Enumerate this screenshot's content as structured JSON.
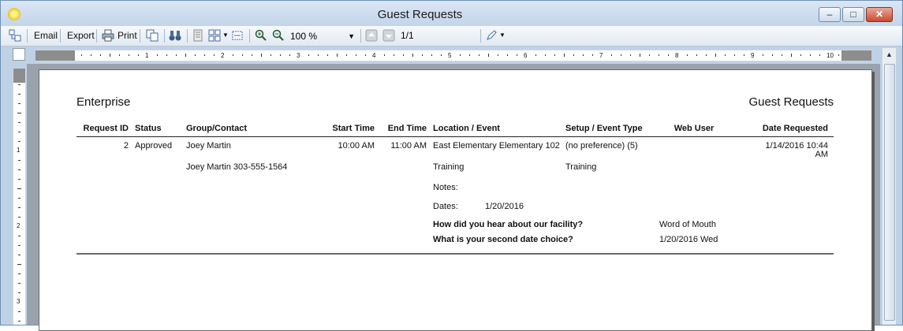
{
  "window": {
    "title": "Guest Requests",
    "minimize": "–",
    "maximize": "□",
    "close": "✕"
  },
  "toolbar": {
    "email": "Email",
    "export": "Export",
    "print": "Print",
    "zoom": "100 %",
    "page": "1/1"
  },
  "ruler": {
    "h_labels": [
      "1",
      "2",
      "3",
      "4",
      "5",
      "6",
      "7",
      "8",
      "9",
      "10"
    ],
    "v_labels": [
      "1",
      "2",
      "3"
    ]
  },
  "report": {
    "left_title": "Enterprise",
    "right_title": "Guest Requests",
    "columns": [
      "Request ID",
      "Status",
      "Group/Contact",
      "Start Time",
      "End Time",
      "Location / Event",
      "Setup / Event Type",
      "Web User",
      "Date Requested"
    ],
    "row": {
      "request_id": "2",
      "status": "Approved",
      "group": "Joey Martin",
      "contact": "Joey Martin 303-555-1564",
      "start_time": "10:00 AM",
      "end_time": "11:00 AM",
      "location": "East Elementary Elementary 102",
      "event": "Training",
      "setup": "(no preference) (5)",
      "event_type": "Training",
      "date_requested_1": "1/14/2016 10:44",
      "date_requested_2": "AM",
      "notes_label": "Notes:",
      "dates_label": "Dates:",
      "dates_value": "1/20/2016",
      "q1": "How did you hear about our facility?",
      "a1": "Word of Mouth",
      "q2": "What is your second date choice?",
      "a2": "1/20/2016 Wed"
    }
  }
}
